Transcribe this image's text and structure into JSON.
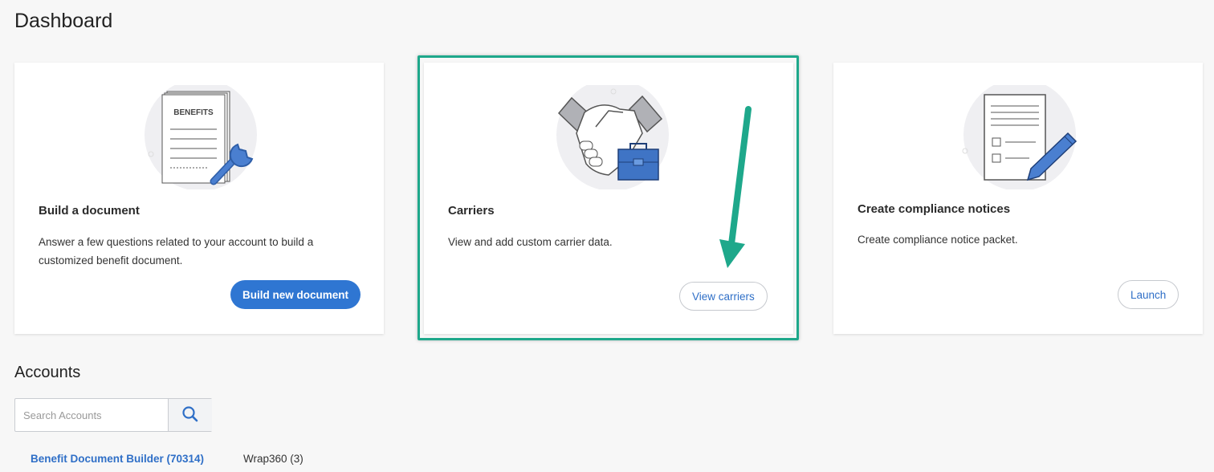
{
  "page": {
    "title": "Dashboard"
  },
  "cards": [
    {
      "title": "Build a document",
      "description": "Answer a few questions related to your account to build a customized benefit document.",
      "button_label": "Build new document",
      "illustration": "benefits-document-wrench-icon",
      "doc_label": "BENEFITS"
    },
    {
      "title": "Carriers",
      "description": "View and add custom carrier data.",
      "button_label": "View carriers",
      "illustration": "handshake-briefcase-icon",
      "highlighted": true
    },
    {
      "title": "Create compliance notices",
      "description": "Create compliance notice packet.",
      "button_label": "Launch",
      "illustration": "checklist-pencil-icon"
    }
  ],
  "accounts": {
    "title": "Accounts",
    "search": {
      "placeholder": "Search Accounts",
      "value": ""
    },
    "tabs": [
      {
        "label": "Benefit Document Builder (70314)",
        "active": true
      },
      {
        "label": "Wrap360 (3)",
        "active": false
      }
    ]
  },
  "colors": {
    "primary": "#2f76d2",
    "highlight": "#1ea88b",
    "link": "#2f6fc7"
  }
}
